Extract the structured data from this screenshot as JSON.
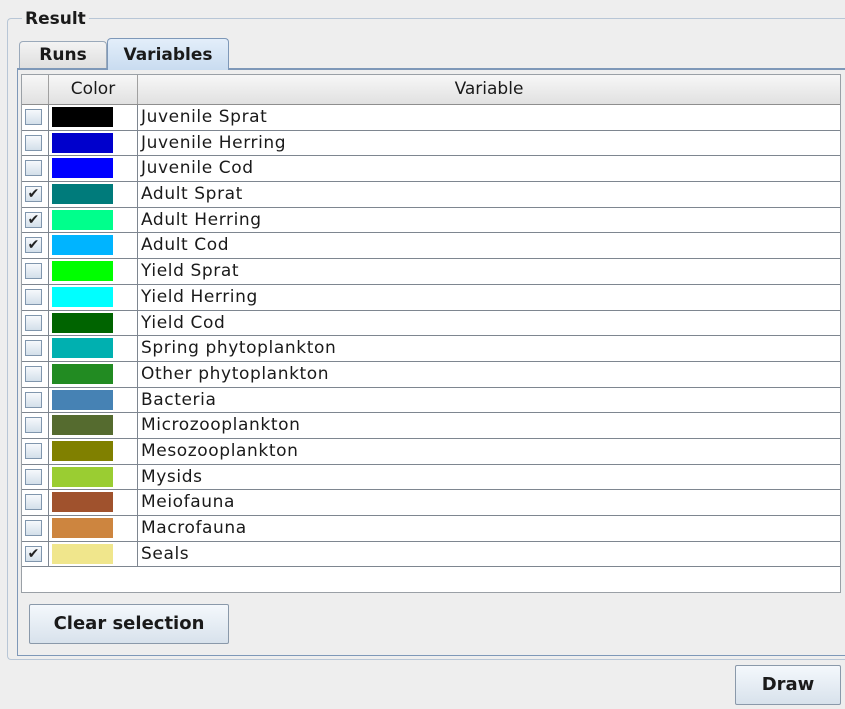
{
  "group": {
    "title": "Result"
  },
  "tabs": [
    {
      "label": "Runs",
      "selected": false
    },
    {
      "label": "Variables",
      "selected": true
    }
  ],
  "table": {
    "columns": [
      "",
      "Color",
      "Variable"
    ],
    "rows": [
      {
        "checked": false,
        "color": "#000000",
        "variable": "Juvenile Sprat"
      },
      {
        "checked": false,
        "color": "#0000cc",
        "variable": "Juvenile Herring"
      },
      {
        "checked": false,
        "color": "#0000ff",
        "variable": "Juvenile Cod"
      },
      {
        "checked": true,
        "color": "#007b7b",
        "variable": "Adult Sprat"
      },
      {
        "checked": true,
        "color": "#00ff8c",
        "variable": "Adult Herring"
      },
      {
        "checked": true,
        "color": "#00b4ff",
        "variable": "Adult Cod"
      },
      {
        "checked": false,
        "color": "#00ff00",
        "variable": "Yield Sprat"
      },
      {
        "checked": false,
        "color": "#00ffff",
        "variable": "Yield Herring"
      },
      {
        "checked": false,
        "color": "#006400",
        "variable": "Yield Cod"
      },
      {
        "checked": false,
        "color": "#00b0b0",
        "variable": "Spring phytoplankton"
      },
      {
        "checked": false,
        "color": "#228b22",
        "variable": "Other phytoplankton"
      },
      {
        "checked": false,
        "color": "#4682b4",
        "variable": "Bacteria"
      },
      {
        "checked": false,
        "color": "#556b2f",
        "variable": "Microzooplankton"
      },
      {
        "checked": false,
        "color": "#808000",
        "variable": "Mesozooplankton"
      },
      {
        "checked": false,
        "color": "#9acd32",
        "variable": "Mysids"
      },
      {
        "checked": false,
        "color": "#a0522d",
        "variable": "Meiofauna"
      },
      {
        "checked": false,
        "color": "#cd853f",
        "variable": "Macrofauna"
      },
      {
        "checked": true,
        "color": "#f0e68c",
        "variable": "Seals"
      }
    ]
  },
  "buttons": {
    "clear_selection": "Clear selection",
    "draw": "Draw"
  },
  "check_glyph": "✔"
}
